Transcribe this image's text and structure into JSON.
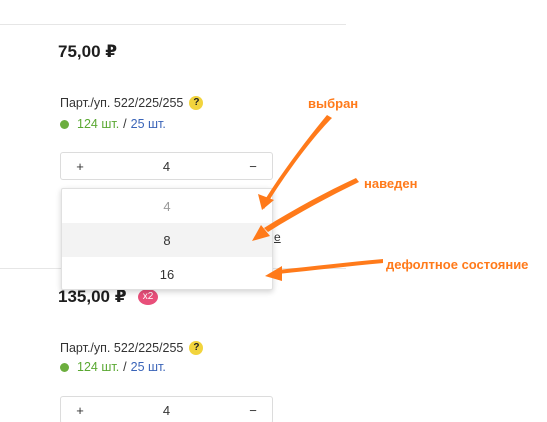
{
  "products": [
    {
      "price": "75,00 ₽",
      "part_label": "Парт./уп. 522/225/255",
      "help_icon": "?",
      "stock_a": "124 шт.",
      "stock_sep": "/",
      "stock_b": "25 шт.",
      "stepper": {
        "minus": "−",
        "plus": "+",
        "value": "4"
      }
    },
    {
      "price": "135,00 ₽",
      "badge": "x2",
      "part_label": "Парт./уп. 522/225/255",
      "help_icon": "?",
      "stock_a": "124 шт.",
      "stock_sep": "/",
      "stock_b": "25 шт.",
      "stepper": {
        "minus": "−",
        "plus": "+",
        "value": "4"
      }
    }
  ],
  "dropdown": {
    "options": [
      "4",
      "8",
      "16"
    ],
    "selected_value": "4",
    "hovered_value": "8"
  },
  "partial_text": "е",
  "annotations": {
    "selected": "выбран",
    "hovered": "наведен",
    "default": "дефолтное состояние",
    "color": "#ff7a1a"
  },
  "colors": {
    "stock_green": "#5aa832",
    "stock_blue": "#3a64b8",
    "help_yellow": "#f2d43d",
    "badge_pink": "#e84f7a"
  }
}
